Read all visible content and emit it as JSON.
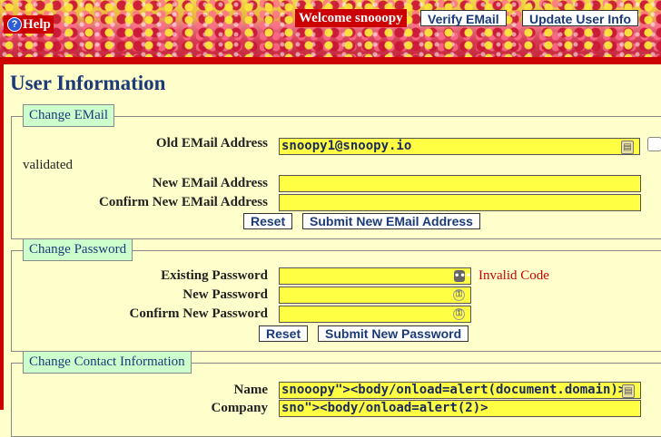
{
  "header": {
    "help_label": "Help",
    "help_icon": "question-circle-icon",
    "welcome_text": "Welcome snooopy",
    "verify_email_label": "Verify EMail",
    "update_user_info_label": "Update User Info"
  },
  "page_title": "User Information",
  "change_email": {
    "legend": "Change EMail",
    "old_label": "Old EMail Address",
    "old_value": "snoopy1@snoopy.io",
    "status_text": "validated",
    "new_label": "New EMail Address",
    "new_value": "",
    "confirm_label": "Confirm New EMail Address",
    "confirm_value": "",
    "reset_label": "Reset",
    "submit_label": "Submit New EMail Address"
  },
  "change_password": {
    "legend": "Change Password",
    "existing_label": "Existing Password",
    "error_text": "Invalid Code",
    "new_label": "New Password",
    "confirm_label": "Confirm New Password",
    "reset_label": "Reset",
    "submit_label": "Submit New Password"
  },
  "change_contact": {
    "legend": "Change Contact Information",
    "name_label": "Name",
    "name_value": "snooopy\"><body/onload=alert(document.domain)>",
    "company_label": "Company",
    "company_value": "sno\"><body/onload=alert(2)>"
  },
  "colors": {
    "accent_red": "#cc0000",
    "page_bg": "#ffffcc",
    "input_bg": "#ffff44",
    "legend_bg": "#ccffcc",
    "title_blue": "#1a3a7a",
    "error_red": "#cc0000"
  }
}
